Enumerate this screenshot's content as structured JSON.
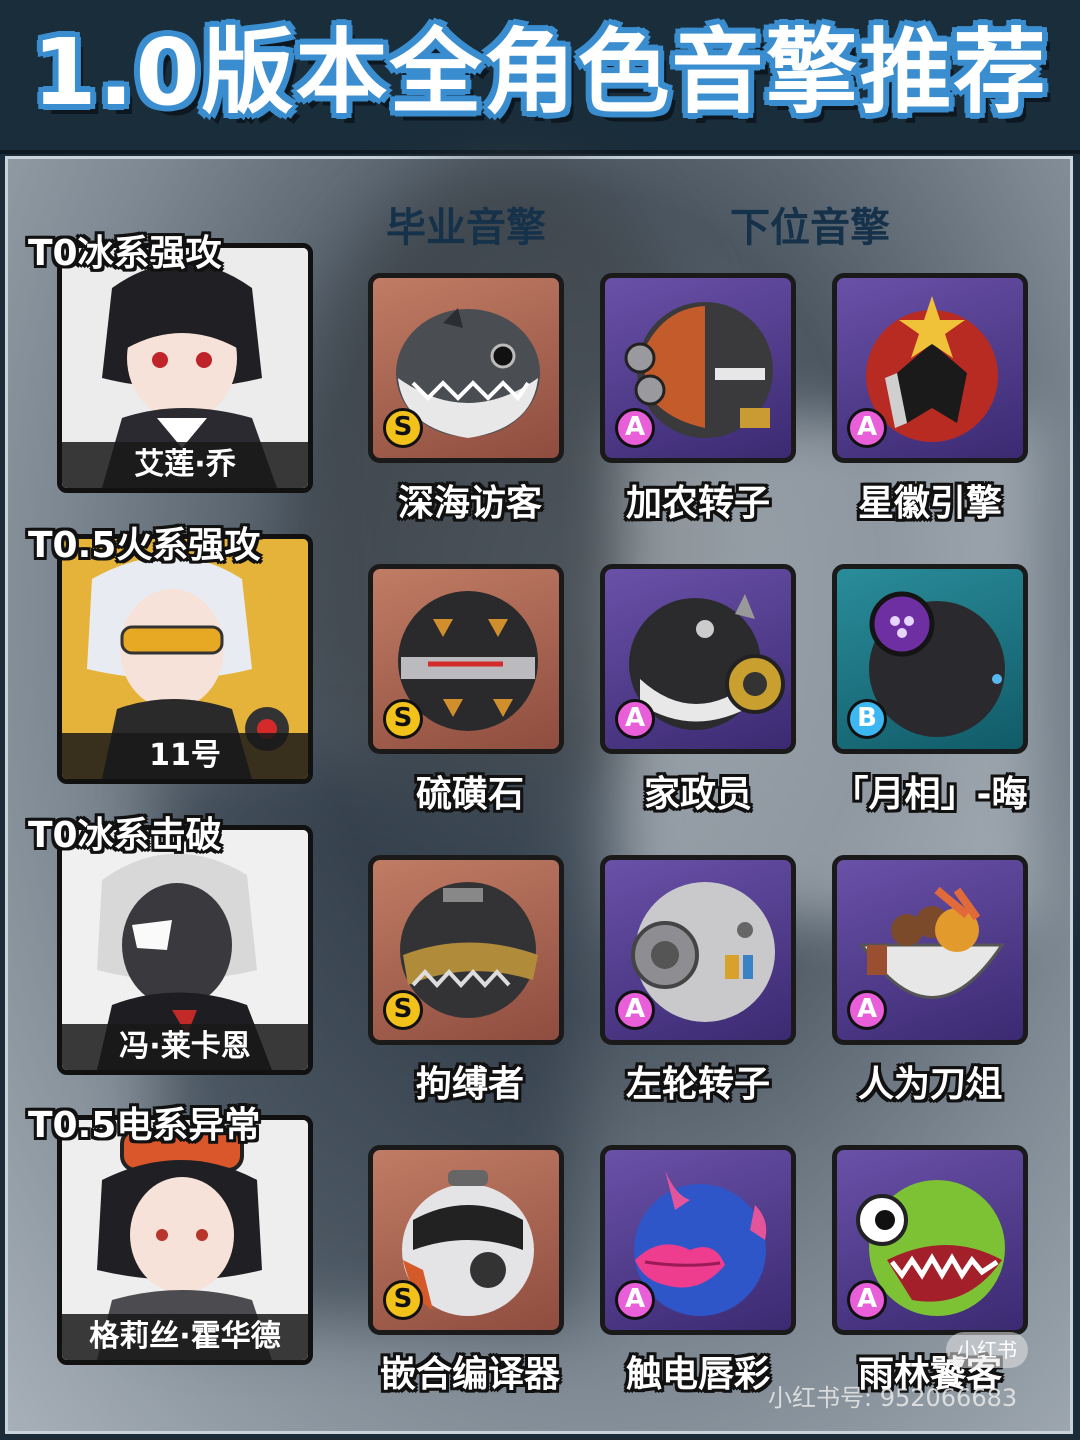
{
  "title": "1.0版本全角色音擎推荐",
  "columns": {
    "best": "毕业音擎",
    "alt": "下位音擎"
  },
  "rows": [
    {
      "tier": "T0冰系强攻",
      "character": "艾莲·乔",
      "engines": [
        {
          "name": "深海访客",
          "rank": "S"
        },
        {
          "name": "加农转子",
          "rank": "A"
        },
        {
          "name": "星徽引擎",
          "rank": "A"
        }
      ]
    },
    {
      "tier": "T0.5火系强攻",
      "character": "11号",
      "engines": [
        {
          "name": "硫磺石",
          "rank": "S"
        },
        {
          "name": "家政员",
          "rank": "A"
        },
        {
          "name": "「月相」-晦",
          "rank": "B"
        }
      ]
    },
    {
      "tier": "T0冰系击破",
      "character": "冯·莱卡恩",
      "engines": [
        {
          "name": "拘缚者",
          "rank": "S"
        },
        {
          "name": "左轮转子",
          "rank": "A"
        },
        {
          "name": "人为刀俎",
          "rank": "A"
        }
      ]
    },
    {
      "tier": "T0.5电系异常",
      "character": "格莉丝·霍华德",
      "engines": [
        {
          "name": "嵌合编译器",
          "rank": "S"
        },
        {
          "name": "触电唇彩",
          "rank": "A"
        },
        {
          "name": "雨林饕客",
          "rank": "A"
        }
      ]
    }
  ],
  "watermark": {
    "text": "小红书号: 952066683",
    "logo": "小红书"
  }
}
